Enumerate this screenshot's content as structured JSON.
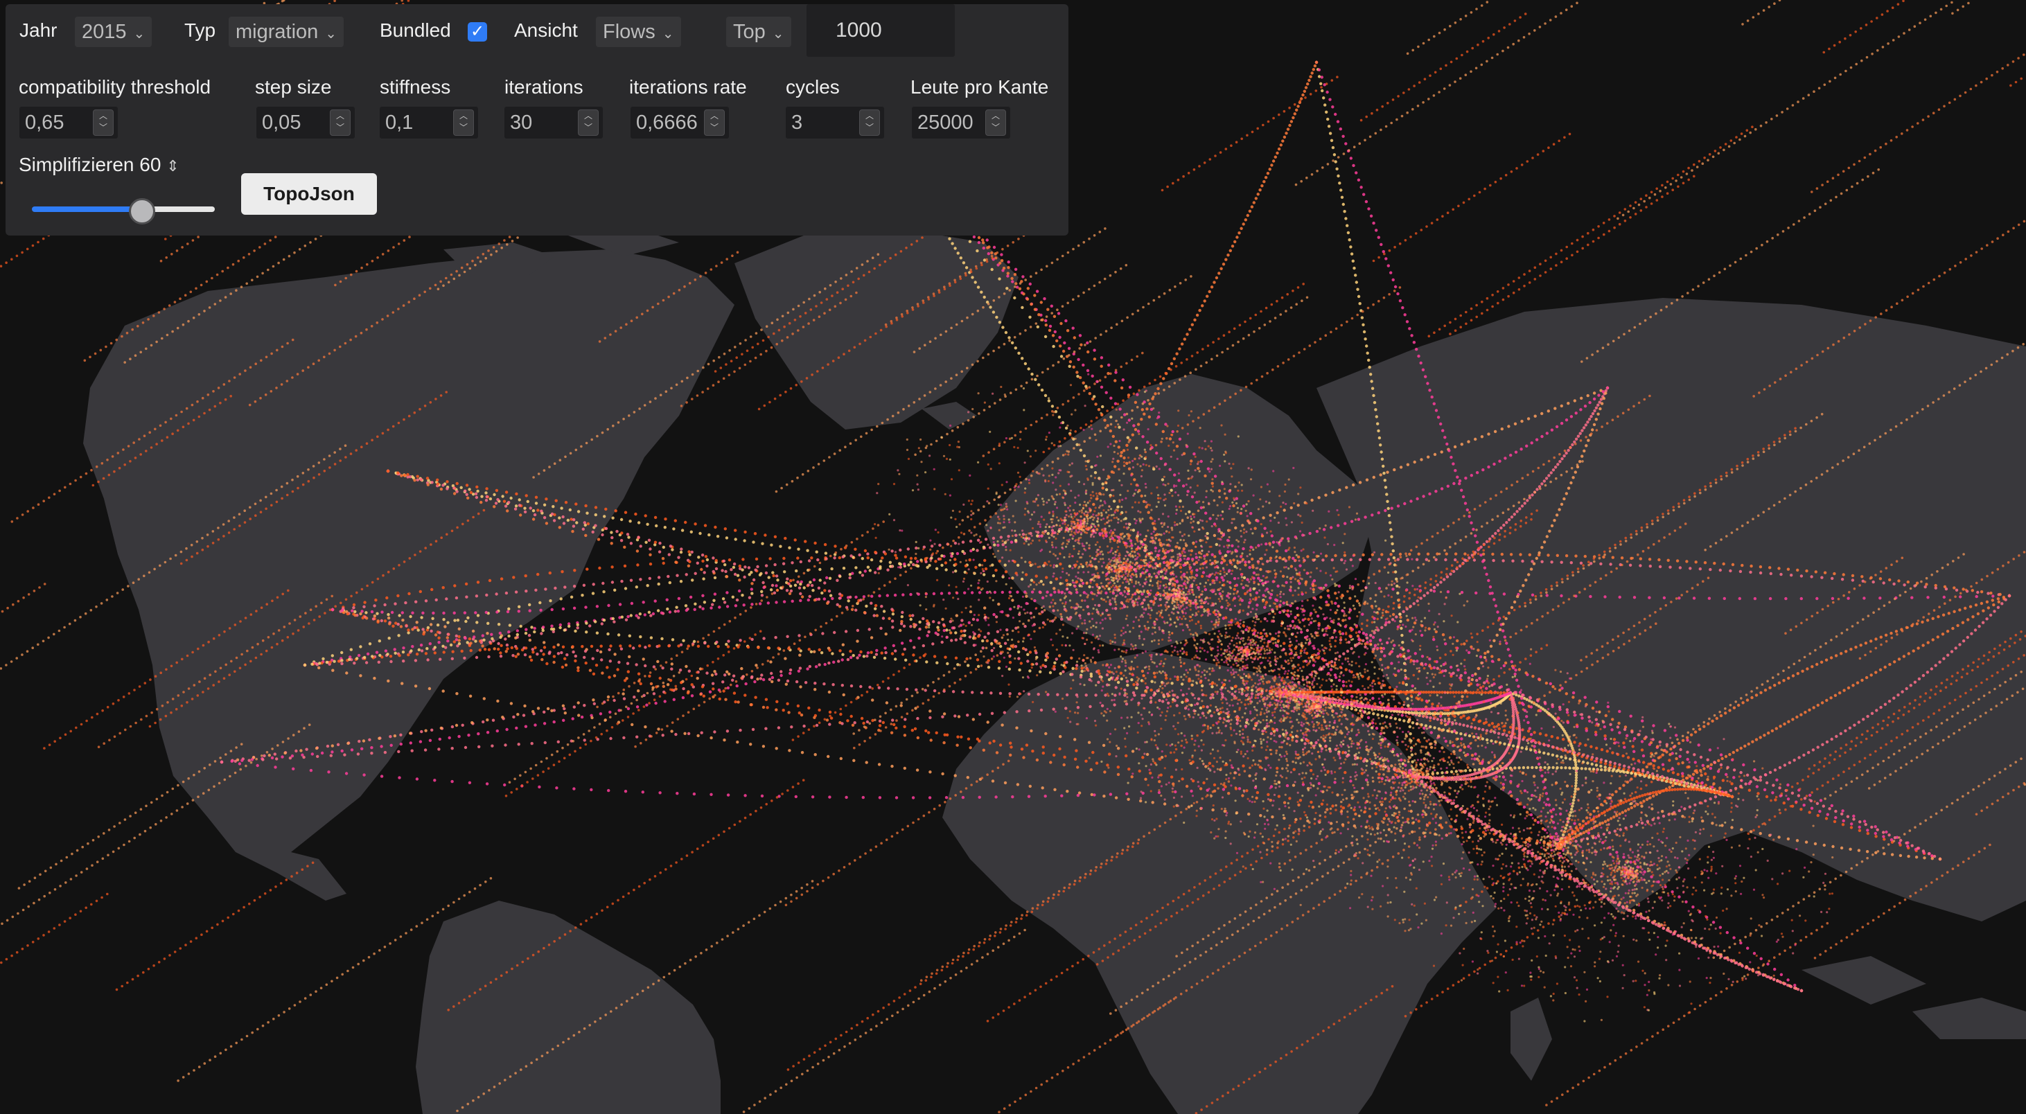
{
  "controls": {
    "year": {
      "label": "Jahr",
      "value": "2015"
    },
    "type": {
      "label": "Typ",
      "value": "migration"
    },
    "bundled": {
      "label": "Bundled",
      "checked": true
    },
    "view": {
      "label": "Ansicht",
      "value": "Flows"
    },
    "top": {
      "value": "Top",
      "count": "1000"
    }
  },
  "params": [
    {
      "label": "compatibility threshold",
      "value": "0,65"
    },
    {
      "label": "step size",
      "value": "0,05"
    },
    {
      "label": "stiffness",
      "value": "0,1"
    },
    {
      "label": "iterations",
      "value": "30"
    },
    {
      "label": "iterations rate",
      "value": "0,6666"
    },
    {
      "label": "cycles",
      "value": "3"
    },
    {
      "label": "Leute pro Kante",
      "value": "25000"
    }
  ],
  "simplify": {
    "label": "Simplifizieren 60",
    "value": 60,
    "level": 0.57
  },
  "buttons": {
    "topojson": "TopoJson"
  },
  "colors": {
    "background": "#121212",
    "land": "#39383c",
    "panel": "#2a2a2c",
    "accent": "#2f7cf6",
    "flow_palette": [
      "#ff5a1f",
      "#ff7a3a",
      "#ff9e5a",
      "#ffd27a",
      "#ff6e8a",
      "#ff3d9a"
    ]
  }
}
